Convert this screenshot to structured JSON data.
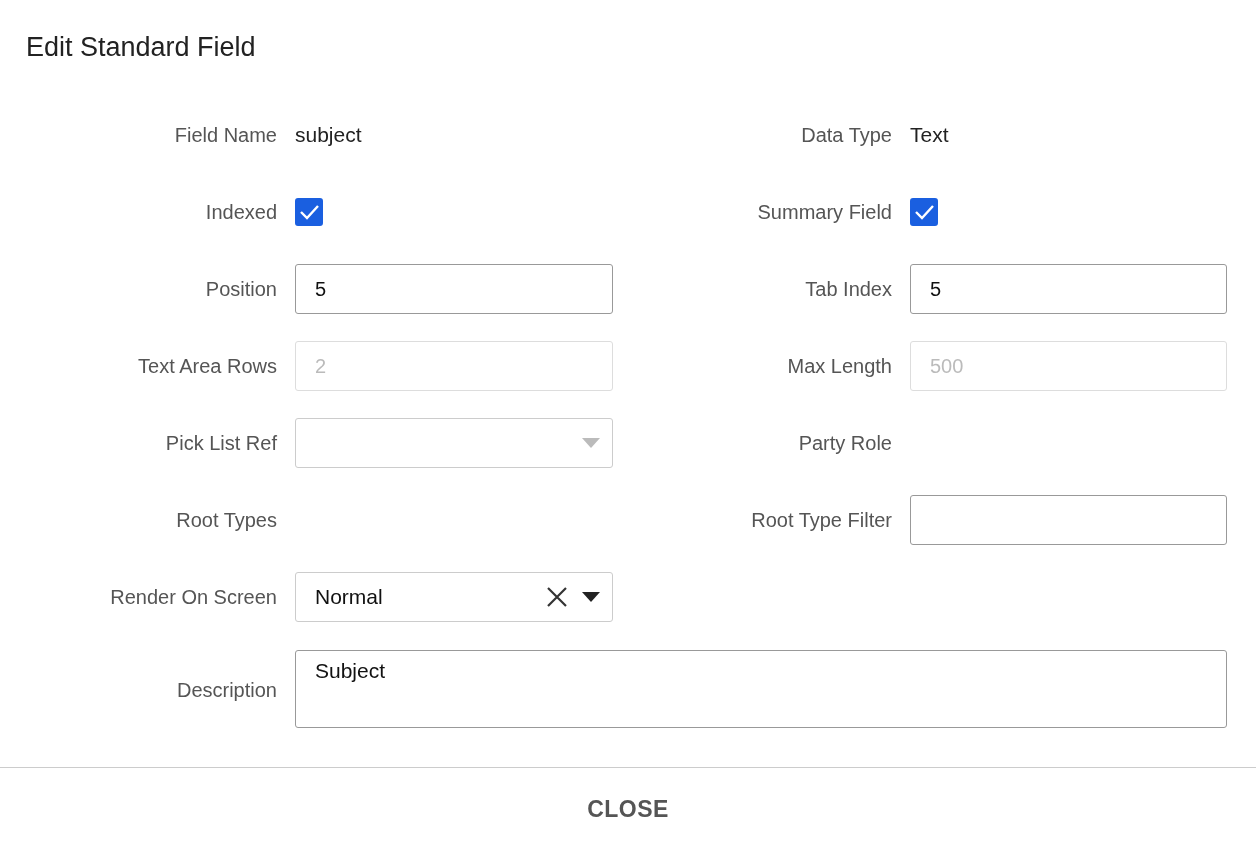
{
  "dialog": {
    "title": "Edit Standard Field"
  },
  "rows": [
    {
      "left": {
        "label": "Field Name",
        "kind": "text",
        "value": "subject"
      },
      "right": {
        "label": "Data Type",
        "kind": "text",
        "value": "Text"
      }
    },
    {
      "left": {
        "label": "Indexed",
        "kind": "checkbox",
        "checked": true
      },
      "right": {
        "label": "Summary Field",
        "kind": "checkbox",
        "checked": true
      }
    },
    {
      "left": {
        "label": "Position",
        "kind": "input",
        "value": "5",
        "disabled": false
      },
      "right": {
        "label": "Tab Index",
        "kind": "input",
        "value": "5",
        "disabled": false
      }
    },
    {
      "left": {
        "label": "Text Area Rows",
        "kind": "input",
        "value": "2",
        "disabled": true
      },
      "right": {
        "label": "Max Length",
        "kind": "input",
        "value": "500",
        "disabled": true
      }
    },
    {
      "left": {
        "label": "Pick List Ref",
        "kind": "select"
      },
      "right": {
        "label": "Party Role",
        "kind": "label"
      }
    },
    {
      "left": {
        "label": "Root Types",
        "kind": "label"
      },
      "right": {
        "label": "Root Type Filter",
        "kind": "input",
        "disabled": false
      }
    },
    {
      "left": {
        "label": "Render On Screen",
        "kind": "combo",
        "value": "Normal"
      }
    },
    {
      "left": {
        "label": "Description",
        "kind": "textarea",
        "value": "Subject"
      }
    }
  ],
  "footer": {
    "button": "CLOSE"
  }
}
